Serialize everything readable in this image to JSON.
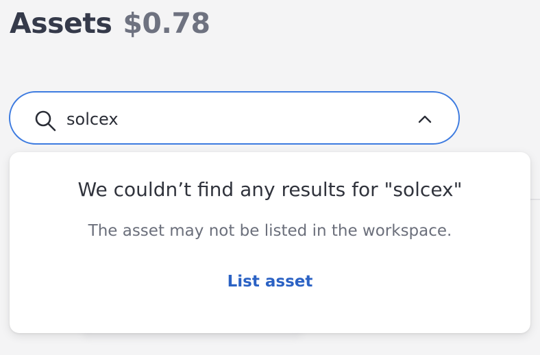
{
  "header": {
    "title": "Assets",
    "balance": "$0.78"
  },
  "search": {
    "value": "solcex",
    "placeholder": "",
    "icon": "search-icon",
    "toggle_icon": "chevron-up-icon"
  },
  "results": {
    "message": "We couldn’t find any results for \"solcex\"",
    "hint": "The asset may not be listed in the workspace.",
    "action_label": "List asset"
  },
  "colors": {
    "accent": "#3d7be0",
    "link": "#2b62c4",
    "background": "#f4f4f5"
  }
}
